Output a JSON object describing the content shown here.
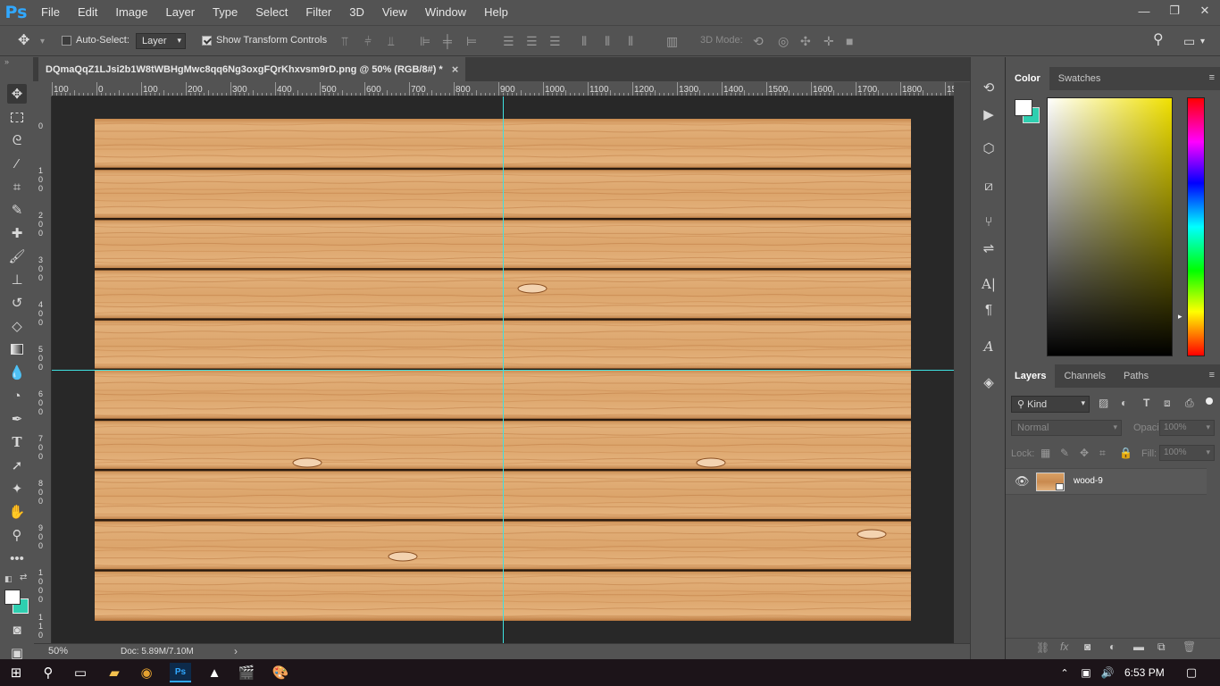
{
  "app": {
    "logo": "Ps",
    "colors": {
      "accent": "#31a8ff",
      "guide": "#3ee0e0",
      "fg": "#ffffff",
      "bg": "#2ecfb0"
    }
  },
  "menu": [
    "File",
    "Edit",
    "Image",
    "Layer",
    "Type",
    "Select",
    "Filter",
    "3D",
    "View",
    "Window",
    "Help"
  ],
  "window_controls": {
    "minimize": "—",
    "restore": "❐",
    "close": "✕"
  },
  "options": {
    "auto_select_label": "Auto-Select:",
    "auto_select_value": "Layer",
    "transform_label": "Show Transform Controls",
    "mode3d_label": "3D Mode:"
  },
  "document": {
    "tab_title": "DQmaQqZ1LJsi2b1W8tWBHgMwc8qq6Ng3oxgFQrKhxvsm9rD.png @ 50% (RGB/8#) *",
    "close": "×"
  },
  "ruler_h": [
    "100",
    "0",
    "100",
    "200",
    "300",
    "400",
    "500",
    "600",
    "700",
    "800",
    "900",
    "1000",
    "1100",
    "1200",
    "1300",
    "1400",
    "1500",
    "1600",
    "1700",
    "1800",
    "15"
  ],
  "ruler_v": [
    "0",
    "1 0 0",
    "2 0 0",
    "3 0 0",
    "4 0 0",
    "5 0 0",
    "6 0 0",
    "7 0 0",
    "8 0 0",
    "9 0 0",
    "1 0 0 0",
    "1 1 0"
  ],
  "status": {
    "zoom": "50%",
    "doc": "Doc: 5.89M/7.10M",
    "arrow": "›"
  },
  "color_panel": {
    "tabs": [
      "Color",
      "Swatches"
    ],
    "menu": "≡"
  },
  "layers_panel": {
    "tabs": [
      "Layers",
      "Channels",
      "Paths"
    ],
    "menu": "≡",
    "kind_label": "Kind",
    "blend_mode": "Normal",
    "opacity_label": "Opacity:",
    "opacity_value": "100%",
    "lock_label": "Lock:",
    "fill_label": "Fill:",
    "fill_value": "100%",
    "layer_name": "wood-9"
  },
  "tools": [
    "move-tool",
    "marquee-tool",
    "lasso-tool",
    "magic-wand-tool",
    "crop-tool",
    "eyedropper-tool",
    "healing-brush-tool",
    "brush-tool",
    "clone-stamp-tool",
    "history-brush-tool",
    "eraser-tool",
    "gradient-tool",
    "blur-tool",
    "dodge-tool",
    "pen-tool",
    "type-tool",
    "path-selection-tool",
    "shape-tool",
    "hand-tool",
    "zoom-tool",
    "more-tools"
  ],
  "taskbar": {
    "time": "6:53 PM"
  }
}
